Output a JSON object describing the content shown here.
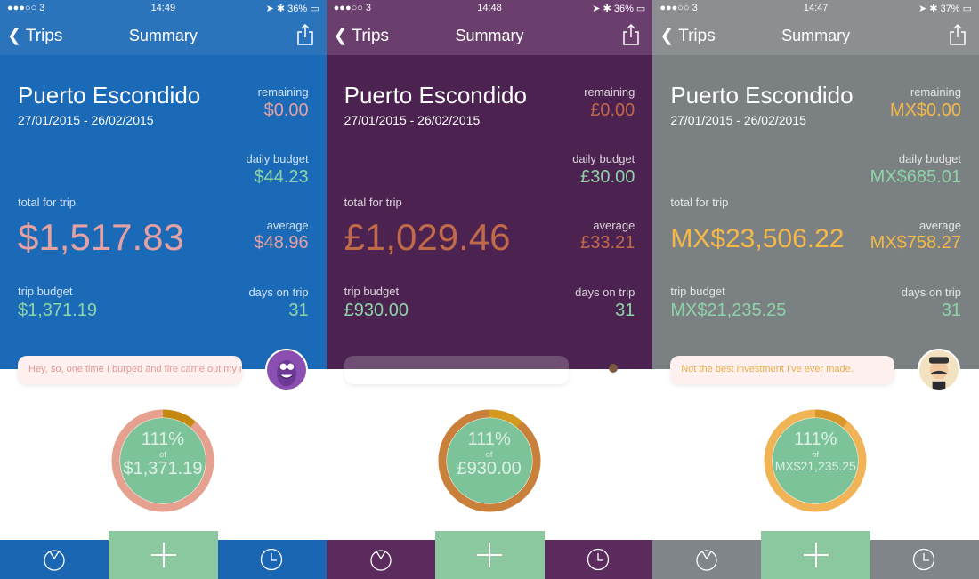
{
  "panels": [
    {
      "theme": {
        "header": "#1a6ab8",
        "nav": "#2b74bb",
        "tab": "#1b66b3",
        "remaining": "#e3a1a3",
        "total": "#e3a1a3",
        "good": "#8fd4a8",
        "ring": "#e6a08f",
        "arc": "#c48a10"
      },
      "status": {
        "carrier": "●●●○○ 3",
        "time": "14:49",
        "battery": "36%"
      },
      "nav": {
        "back": "Trips",
        "title": "Summary"
      },
      "trip_name": "Puerto Escondido",
      "dates": "27/01/2015 - 26/02/2015",
      "remaining_label": "remaining",
      "remaining": "$0.00",
      "daily_label": "daily budget",
      "daily": "$44.23",
      "total_label": "total for trip",
      "total": "$1,517.83",
      "average_label": "average",
      "average": "$48.96",
      "budget_label": "trip budget",
      "budget": "$1,371.19",
      "days_label": "days on trip",
      "days": "31",
      "bubble": "Hey, so, one time I burped and fire came out my nose.",
      "bubble_color": "#e39a9a",
      "avatar": "purple-monster-avatar",
      "progress": {
        "percent": "111%",
        "of": "of",
        "amount": "$1,371.19",
        "value": 1.11
      }
    },
    {
      "theme": {
        "header": "#4c2350",
        "nav": "#6b3f6d",
        "tab": "#5a2b5c",
        "remaining": "#c0674a",
        "total": "#c06a4a",
        "good": "#8fd4a8",
        "ring": "#c9803a",
        "arc": "#d49a20"
      },
      "status": {
        "carrier": "●●●○○ 3",
        "time": "14:48",
        "battery": "36%"
      },
      "nav": {
        "back": "Trips",
        "title": "Summary"
      },
      "trip_name": "Puerto Escondido",
      "dates": "27/01/2015 - 26/02/2015",
      "remaining_label": "remaining",
      "remaining": "£0.00",
      "daily_label": "daily budget",
      "daily": "£30.00",
      "total_label": "total for trip",
      "total": "£1,029.46",
      "average_label": "average",
      "average": "£33.21",
      "budget_label": "trip budget",
      "budget": "£930.00",
      "days_label": "days on trip",
      "days": "31",
      "bubble": "",
      "bubble_color": "#c8a0c0",
      "avatar": "small-avatar",
      "progress": {
        "percent": "111%",
        "of": "of",
        "amount": "£930.00",
        "value": 1.11
      }
    },
    {
      "theme": {
        "header": "#7b8083",
        "nav": "#8b8f92",
        "tab": "#80858a",
        "remaining": "#f5b94a",
        "total": "#f5b94a",
        "good": "#8fd4a8",
        "ring": "#f0b457",
        "arc": "#d9962a"
      },
      "status": {
        "carrier": "●●●○○ 3",
        "time": "14:47",
        "battery": "37%"
      },
      "nav": {
        "back": "Trips",
        "title": "Summary"
      },
      "trip_name": "Puerto Escondido",
      "dates": "27/01/2015 - 26/02/2015",
      "remaining_label": "remaining",
      "remaining": "MX$0.00",
      "daily_label": "daily budget",
      "daily": "MX$685.01",
      "total_label": "total for trip",
      "total": "MX$23,506.22",
      "average_label": "average",
      "average": "MX$758.27",
      "budget_label": "trip budget",
      "budget": "MX$21,235.25",
      "days_label": "days on trip",
      "days": "31",
      "bubble": "Not the best investment I've ever made.",
      "bubble_color": "#e8b04a",
      "avatar": "mustache-man-avatar",
      "progress": {
        "percent": "111%",
        "of": "of",
        "amount": "MX$21,235.25",
        "value": 1.11
      }
    }
  ]
}
